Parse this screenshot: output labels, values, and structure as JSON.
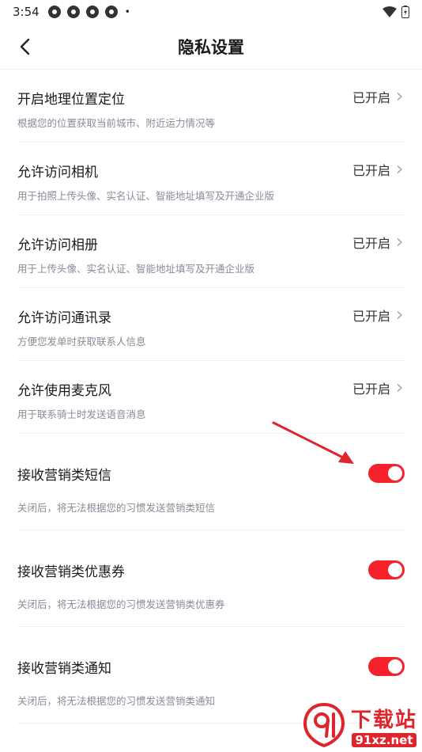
{
  "status_bar": {
    "time": "3:54",
    "dot": "•"
  },
  "nav": {
    "title": "隐私设置"
  },
  "permissions": [
    {
      "title": "开启地理位置定位",
      "desc": "根据您的位置获取当前城市、附近运力情况等",
      "status": "已开启"
    },
    {
      "title": "允许访问相机",
      "desc": "用于拍照上传头像、实名认证、智能地址填写及开通企业版",
      "status": "已开启"
    },
    {
      "title": "允许访问相册",
      "desc": "用于上传头像、实名认证、智能地址填写及开通企业版",
      "status": "已开启"
    },
    {
      "title": "允许访问通讯录",
      "desc": "方便您发单时获取联系人信息",
      "status": "已开启"
    },
    {
      "title": "允许使用麦克风",
      "desc": "用于联系骑士时发送语音消息",
      "status": "已开启"
    }
  ],
  "toggles": [
    {
      "title": "接收营销类短信",
      "desc": "关闭后，将无法根据您的习惯发送营销类短信",
      "on": true
    },
    {
      "title": "接收营销类优惠券",
      "desc": "关闭后，将无法根据您的习惯发送营销类优惠券",
      "on": true
    },
    {
      "title": "接收营销类通知",
      "desc": "关闭后，将无法根据您的习惯发送营销类通知",
      "on": true
    }
  ],
  "colors": {
    "accent": "#f5222d",
    "watermark": "#e0242b"
  },
  "watermark": {
    "cn": "下载站",
    "url": "91xz.net"
  }
}
